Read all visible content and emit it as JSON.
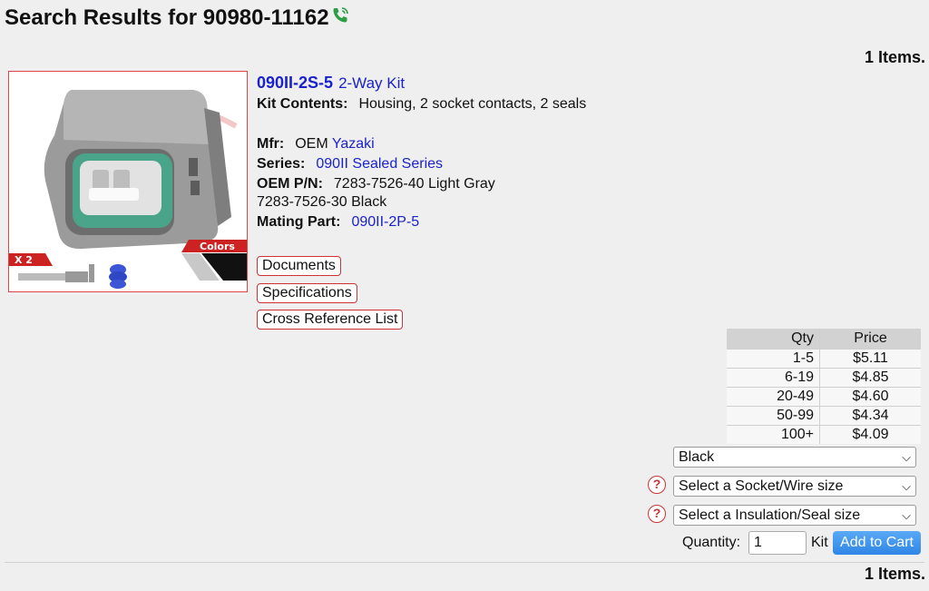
{
  "header": {
    "title": "Search Results for 90980-11162",
    "items_count_top": "1 Items.",
    "items_count_bottom": "1 Items."
  },
  "product": {
    "part_number": "090II-2S-5",
    "kit_label": "2-Way Kit",
    "kit_contents_label": "Kit Contents:",
    "kit_contents": "Housing, 2 socket contacts, 2 seals",
    "mfr_label": "Mfr:",
    "mfr_prefix": "OEM",
    "mfr_name": "Yazaki",
    "series_label": "Series:",
    "series": "090II Sealed Series",
    "oem_pn_label": "OEM P/N:",
    "oem_pn_1": "7283-7526-40 Light Gray",
    "oem_pn_2": "7283-7526-30 Black",
    "mating_label": "Mating Part:",
    "mating_part": "090II-2P-5",
    "image_badge_qty": "X 2",
    "image_badge_colors": "Colors"
  },
  "buttons": {
    "documents": "Documents",
    "specifications": "Specifications",
    "cross_reference": "Cross Reference List",
    "add_to_cart": "Add to Cart"
  },
  "price_table": {
    "headers": {
      "qty": "Qty",
      "price": "Price"
    },
    "rows": [
      {
        "qty": "1-5",
        "price": "$5.11"
      },
      {
        "qty": "6-19",
        "price": "$4.85"
      },
      {
        "qty": "20-49",
        "price": "$4.60"
      },
      {
        "qty": "50-99",
        "price": "$4.34"
      },
      {
        "qty": "100+",
        "price": "$4.09"
      }
    ]
  },
  "options": {
    "color_selected": "Black",
    "socket_selected": "Select a Socket/Wire size",
    "seal_selected": "Select a Insulation/Seal size"
  },
  "quantity": {
    "label": "Quantity:",
    "value": "1",
    "unit": "Kit"
  },
  "icons": {
    "phone": "phone-icon",
    "help": "question-circle-icon",
    "dropdown": "chevron-down-icon"
  },
  "colors": {
    "link": "#1a23c9",
    "accent_red": "#cc3333",
    "cart_button": "#2f86e6",
    "phone_green": "#2e9e44"
  }
}
